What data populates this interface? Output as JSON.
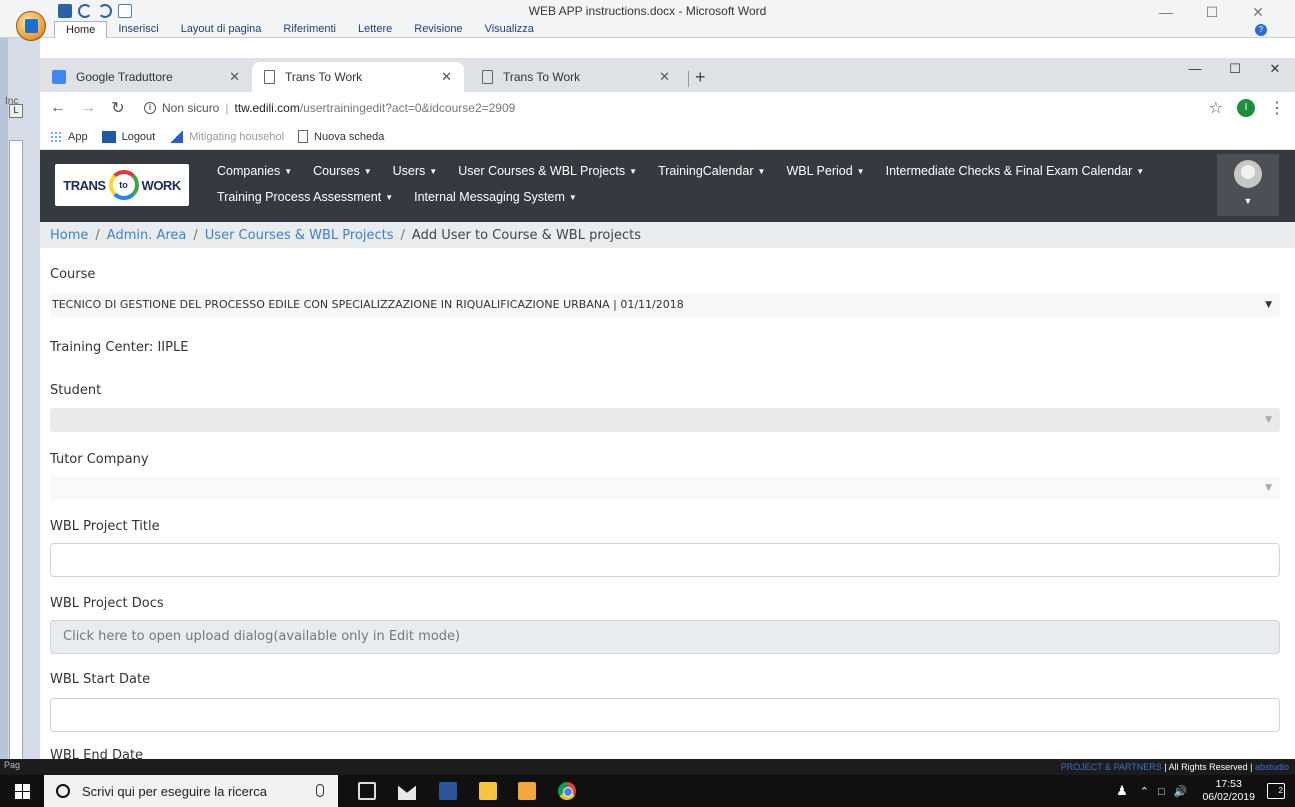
{
  "word": {
    "doc_title": "WEB APP instructions.docx - Microsoft Word",
    "ribbon_tabs": [
      "Home",
      "Inserisci",
      "Layout di pagina",
      "Riferimenti",
      "Lettere",
      "Revisione",
      "Visualizza"
    ],
    "side_labels": [
      "Inc",
      "Pag"
    ]
  },
  "browser": {
    "tabs": [
      {
        "title": "Google Traduttore",
        "icon": "google-translate-icon"
      },
      {
        "title": "Trans To Work",
        "icon": "page-icon"
      },
      {
        "title": "Trans To Work",
        "icon": "page-icon"
      }
    ],
    "active_tab": 1,
    "security_label": "Non sicuro",
    "url_host": "ttw.edili.com",
    "url_path": "/usertrainingedit?act=0&idcourse2=2909",
    "profile_initial": "I",
    "bookmarks": [
      {
        "label": "App",
        "icon": "apps-grid-icon"
      },
      {
        "label": "Logout",
        "icon": "logout-site-icon"
      },
      {
        "label": "Mitigating househol",
        "icon": "mitigating-site-icon"
      },
      {
        "label": "Nuova scheda",
        "icon": "page-icon"
      }
    ]
  },
  "app": {
    "brand": {
      "left": "TRANS",
      "mid": "to",
      "right": "WORK"
    },
    "nav_row1": [
      "Companies",
      "Courses",
      "Users",
      "User Courses & WBL Projects",
      "TrainingCalendar",
      "WBL Period",
      "Intermediate Checks & Final Exam Calendar"
    ],
    "nav_row2": [
      "Training Process Assessment",
      "Internal Messaging System"
    ],
    "breadcrumb": {
      "links": [
        "Home",
        "Admin. Area",
        "User Courses & WBL Projects"
      ],
      "current": "Add User to Course & WBL projects"
    },
    "form": {
      "course_label": "Course",
      "course_value": "TECNICO DI GESTIONE DEL PROCESSO EDILE CON SPECIALIZZAZIONE IN RIQUALIFICAZIONE URBANA | 01/11/2018",
      "training_center": "Training Center: IIPLE",
      "student_label": "Student",
      "student_value": "",
      "tutor_label": "Tutor Company",
      "tutor_value": "",
      "project_title_label": "WBL Project Title",
      "project_title_value": "",
      "project_docs_label": "WBL Project Docs",
      "project_docs_text": "Click here to open upload dialog(available only in Edit mode)",
      "start_date_label": "WBL Start Date",
      "start_date_value": "",
      "end_date_label": "WBL End Date"
    },
    "footer": {
      "brand": "PROJECT & PARTNERS",
      "rights": " | All Rights Reserved | ",
      "studio": "abstudio"
    }
  },
  "taskbar": {
    "search_placeholder": "Scrivi qui per eseguire la ricerca",
    "time": "17:53",
    "date": "06/02/2019",
    "notification_count": "2"
  },
  "colors": {
    "navbar": "#343a40",
    "breadcrumb_bg": "#e9ecef",
    "link": "#3b82c4",
    "footer_link": "#3b6fd6"
  }
}
